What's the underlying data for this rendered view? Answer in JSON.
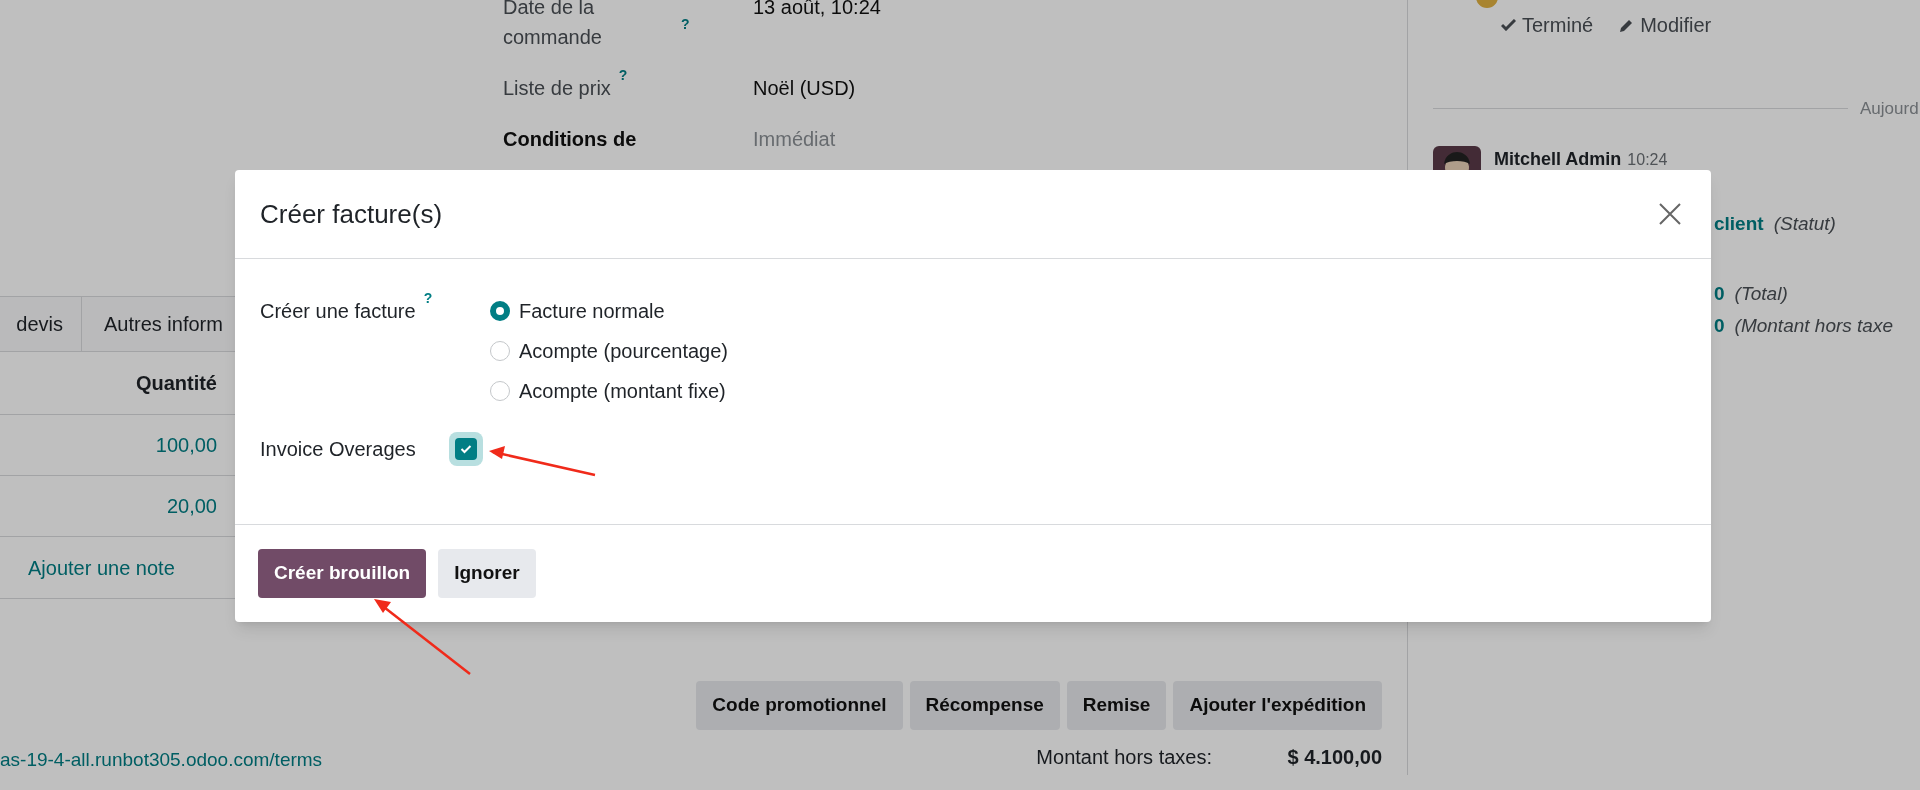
{
  "form_fields": [
    {
      "label": "Date de la commande",
      "help": "?",
      "required": false,
      "value": "13 août, 10:24"
    },
    {
      "label": "Liste de prix",
      "help": "?",
      "required": false,
      "value": "Noël (USD)"
    },
    {
      "label": "Conditions de",
      "required": true,
      "placeholder": "Immédiat"
    }
  ],
  "tabs": [
    {
      "label": "devis",
      "selected": false
    },
    {
      "label": "Autres inform",
      "selected": false
    }
  ],
  "order_lines": {
    "columns": [
      "Quantité"
    ],
    "rows": [
      {
        "quantity": "100,00"
      },
      {
        "quantity": "20,00"
      }
    ],
    "add_note": "Ajouter une note"
  },
  "actions": [
    "Code promotionnel",
    "Récompense",
    "Remise",
    "Ajouter l'expédition"
  ],
  "terms_link": "as-19-4-all.runbot305.odoo.com/terms",
  "totals": [
    {
      "label": "Montant hors taxes:",
      "value": "$ 4.100,00",
      "bold": true
    }
  ],
  "chatter": {
    "activity_actions": [
      {
        "kind": "done",
        "label": "Terminé"
      },
      {
        "kind": "edit",
        "label": "Modifier"
      }
    ],
    "date_separator": "Aujourd",
    "message": {
      "author": "Mitchell Admin",
      "time": "10:24",
      "tracking": [
        {
          "value": "client",
          "field": "(Statut)"
        },
        {
          "value": "0",
          "field": "(Total)"
        },
        {
          "value": "0",
          "field": "(Montant hors taxe"
        }
      ]
    }
  },
  "dialog": {
    "title": "Créer facture(s)",
    "fields": [
      {
        "kind": "radio",
        "label": "Créer une facture",
        "help": "?",
        "options": [
          {
            "label": "Facture normale",
            "selected": true
          },
          {
            "label": "Acompte (pourcentage)",
            "selected": false
          },
          {
            "label": "Acompte (montant fixe)",
            "selected": false
          }
        ]
      },
      {
        "kind": "checkbox",
        "label": "Invoice Overages",
        "checked": true
      }
    ],
    "buttons": [
      {
        "label": "Créer brouillon",
        "primary": true
      },
      {
        "label": "Ignorer",
        "primary": false
      }
    ]
  }
}
